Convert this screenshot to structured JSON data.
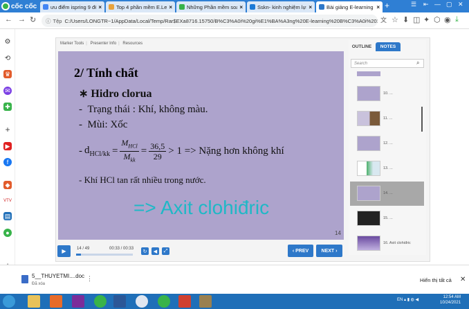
{
  "browser": {
    "logo": "cốc cốc",
    "tabs": [
      {
        "title": "ưu điểm ispring 9 để t",
        "color": "#4285f4"
      },
      {
        "title": "Top 4 phần mềm E.Le",
        "color": "#e8a33d"
      },
      {
        "title": "Những Phần mềm soạ",
        "color": "#38b34a"
      },
      {
        "title": "Sskn- kinh nghiệm lựa",
        "color": "#1c7ad6"
      },
      {
        "title": "Bài giảng E-learning B",
        "color": "#2e78c9"
      }
    ],
    "address_prefix": "Tệp",
    "url": "C:/Users/LONGTR~1/AppData/Local/Temp/Rar$EXa8716.15750/B%C3%A0i%20gi%E1%BA%A3ng%20E-learning%20B%C3%A0i%2023%20hidroclorua%20-%20axit%20clo..."
  },
  "player": {
    "topnav": [
      "Marker Tools",
      "Presenter Info",
      "Resources"
    ],
    "slide": {
      "title": "2/ Tính chất",
      "heading": "Hidro clorua",
      "lines": [
        "Trạng thái : Khí, không màu.",
        "Mùi: Xốc"
      ],
      "formula": {
        "lhs": "d",
        "sub": "HCl/kk",
        "frac1_num": "M",
        "frac1_num_sub": "HCl",
        "frac1_den": "M",
        "frac1_den_sub": "kk",
        "frac2_num": "36,5",
        "frac2_den": "29",
        "rhs": "> 1 => Nặng hơn không khí"
      },
      "solubility": "Khí HCl tan rất nhiều trong nước.",
      "conclusion": "=> Axit clohiđric",
      "number": "14"
    },
    "controls": {
      "slide_count": "14 / 49",
      "time": "00:33 / 00:33",
      "progress": 0.08,
      "prev_label": "‹ PREV",
      "next_label": "NEXT ›"
    },
    "panel": {
      "tabs": [
        "OUTLINE",
        "NOTES"
      ],
      "active_tab": "NOTES",
      "search_placeholder": "Search",
      "thumbnails": [
        {
          "label": "10. ...",
          "active": false
        },
        {
          "label": "11. ...",
          "active": false
        },
        {
          "label": "12. ...",
          "active": false
        },
        {
          "label": "13. ...",
          "active": false
        },
        {
          "label": "14. ...",
          "active": true
        },
        {
          "label": "15. ...",
          "active": false
        },
        {
          "label": "16. Axit clohiđric",
          "active": false
        }
      ]
    }
  },
  "downloads": {
    "file_name": "5__THUYETMI....doc",
    "status": "Đã xóa",
    "show_all": "Hiển thị tất cả"
  },
  "taskbar": {
    "lang": "EN",
    "time": "12:54 AM",
    "date": "10/24/2021"
  }
}
